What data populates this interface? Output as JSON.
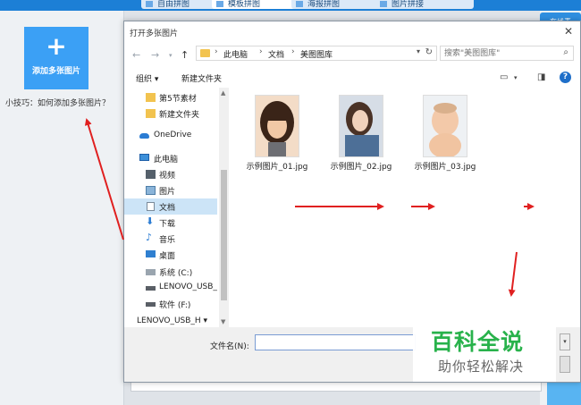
{
  "app": {
    "tabs": [
      {
        "label": "自由拼图"
      },
      {
        "label": "模板拼图"
      },
      {
        "label": "海报拼图"
      },
      {
        "label": "图片拼接"
      }
    ],
    "add_button_label": "添加多张图片",
    "tip": "小技巧：如何添加多张图片？",
    "right_button_label": "在线素"
  },
  "dialog": {
    "title": "打开多张图片",
    "breadcrumb": [
      "此电脑",
      "文档",
      "美图图库"
    ],
    "search_placeholder": "搜索\"美图图库\"",
    "toolbar": {
      "organize": "组织 ▾",
      "new_folder": "新建文件夹"
    },
    "nav_items": [
      {
        "label": "第5节素材",
        "icon": "folder-icon"
      },
      {
        "label": "新建文件夹",
        "icon": "folder-icon"
      },
      {
        "label": "OneDrive",
        "icon": "cloud-icon"
      },
      {
        "label": "此电脑",
        "icon": "computer-icon"
      },
      {
        "label": "视频",
        "icon": "video-icon"
      },
      {
        "label": "图片",
        "icon": "picture-icon"
      },
      {
        "label": "文档",
        "icon": "document-icon",
        "selected": true
      },
      {
        "label": "下载",
        "icon": "download-icon"
      },
      {
        "label": "音乐",
        "icon": "music-icon"
      },
      {
        "label": "桌面",
        "icon": "desktop-icon"
      },
      {
        "label": "系统 (C:)",
        "icon": "drive-icon"
      },
      {
        "label": "LENOVO_USB_",
        "icon": "usb-drive-icon"
      },
      {
        "label": "软件 (F:)",
        "icon": "drive-icon"
      }
    ],
    "nav_bottom": "LENOVO_USB_H ▾",
    "files": [
      {
        "name": "示例图片_01.jpg"
      },
      {
        "name": "示例图片_02.jpg"
      },
      {
        "name": "示例图片_03.jpg"
      }
    ],
    "filename_label": "文件名(N):",
    "filename_value": ""
  },
  "watermark": {
    "main": "百科全说",
    "sub": "助你轻松解决"
  },
  "colors": {
    "accent": "#3ba0f5",
    "arrow": "#e02020",
    "watermark_green": "#28b24b",
    "selection": "#cce4f7"
  }
}
